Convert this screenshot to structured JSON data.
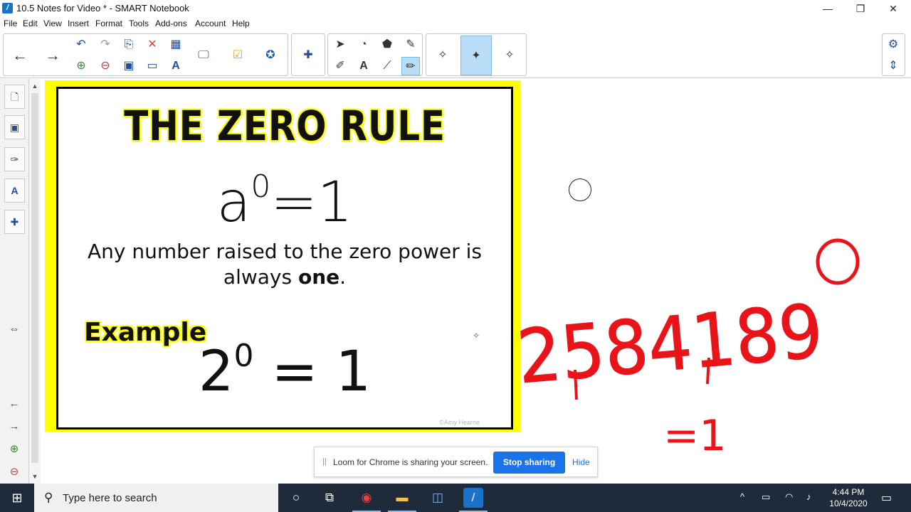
{
  "window": {
    "title": "10.5 Notes for Video * - SMART Notebook",
    "minimize": "—",
    "restore": "❐",
    "close": "✕"
  },
  "menu": [
    "File",
    "Edit",
    "View",
    "Insert",
    "Format",
    "Tools",
    "Add-ons",
    "Account",
    "Help"
  ],
  "slide": {
    "title": "THE ZERO RULE",
    "formula_base": "a",
    "formula_exp": "0",
    "formula_rest": "=1",
    "rule_line1": "Any number raised to the zero power is",
    "rule_line2_pre": "always ",
    "rule_line2_bold": "one",
    "rule_line2_post": ".",
    "example_label": "Example",
    "example_base": "2",
    "example_exp": "0",
    "example_rest": " = 1",
    "credit": "©Amy Hearne"
  },
  "ink": {
    "number": "2584189",
    "exponent": "0",
    "result": "=1",
    "color": "#e8141a"
  },
  "loom": {
    "grip": "||",
    "message": "Loom for Chrome is sharing your screen.",
    "stop_label": "Stop sharing",
    "hide_label": "Hide"
  },
  "taskbar": {
    "search_placeholder": "Type here to search",
    "time": "4:44 PM",
    "date": "10/4/2020"
  },
  "colors": {
    "slide_border": "#ffff00",
    "accent_blue": "#1a73e8",
    "taskbar": "#1f2b3b"
  }
}
